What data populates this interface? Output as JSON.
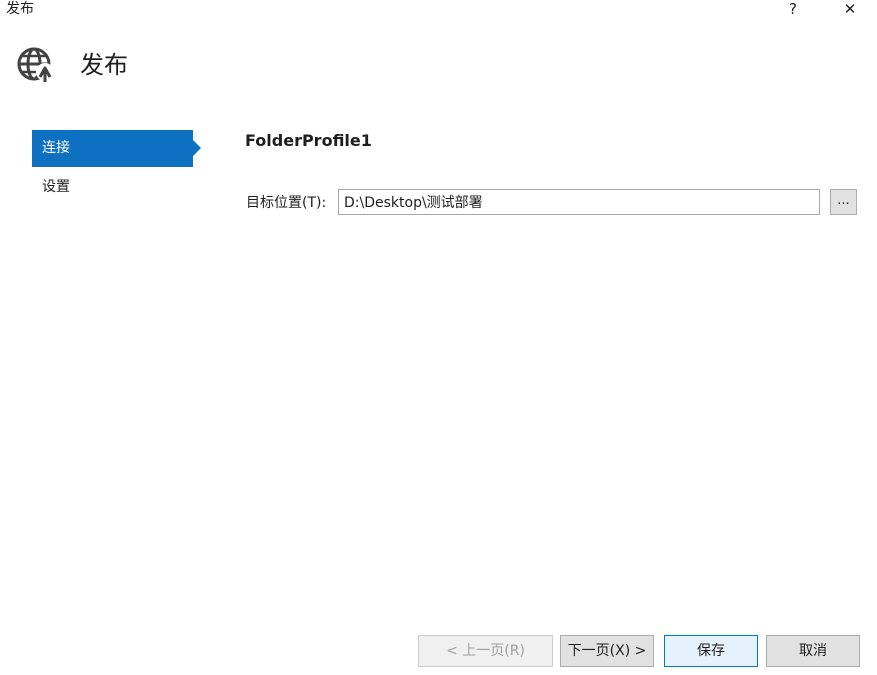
{
  "window": {
    "title": "发布",
    "help_label": "?",
    "close_label": "✕"
  },
  "header": {
    "title": "发布",
    "icon": "globe-publish-icon"
  },
  "nav": {
    "items": [
      {
        "label": "连接",
        "active": true
      },
      {
        "label": "设置",
        "active": false
      }
    ]
  },
  "main": {
    "profile_name": "FolderProfile1",
    "target_label": "目标位置(T):",
    "target_value": "D:\\Desktop\\测试部署",
    "browse_label": "..."
  },
  "footer": {
    "prev_label": "< 上一页(R)",
    "next_label": "下一页(X) >",
    "save_label": "保存",
    "cancel_label": "取消"
  },
  "colors": {
    "accent": "#0e70c0",
    "default_button_border": "#0078d7"
  }
}
